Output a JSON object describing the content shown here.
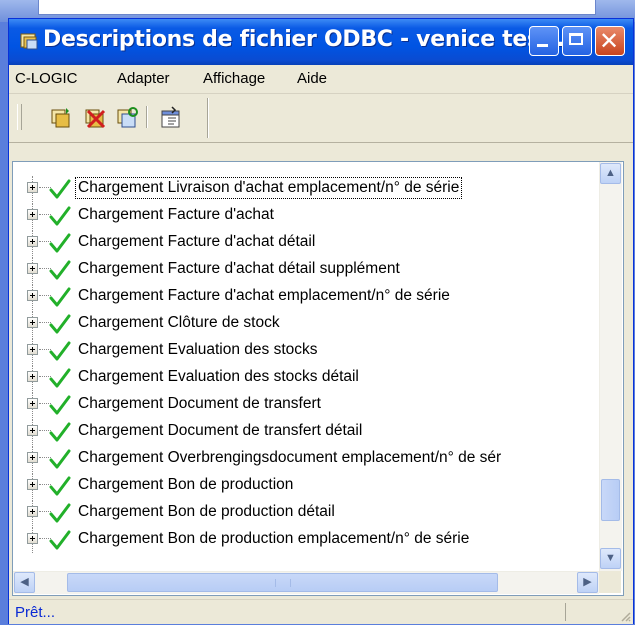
{
  "window": {
    "title": "Descriptions de fichier ODBC - venice tes..."
  },
  "menubar": {
    "items": [
      "C-LOGIC",
      "Adapter",
      "Affichage",
      "Aide"
    ]
  },
  "toolbar": {
    "buttons": [
      "load-icon",
      "delete-icon",
      "refresh-icon",
      "properties-icon"
    ]
  },
  "tree": {
    "items": [
      "Chargement Livraison d'achat emplacement/n° de série",
      "Chargement Facture d'achat",
      "Chargement Facture d'achat détail",
      "Chargement Facture d'achat détail supplément",
      "Chargement Facture d'achat emplacement/n° de série",
      "Chargement Clôture de stock",
      "Chargement Evaluation des stocks",
      "Chargement Evaluation des stocks détail",
      "Chargement Document de transfert",
      "Chargement Document de transfert détail",
      "Chargement Overbrengingsdocument emplacement/n° de sér",
      "Chargement Bon de production",
      "Chargement Bon de production détail",
      "Chargement Bon de production emplacement/n° de série"
    ],
    "selected_index": 0
  },
  "status": {
    "text": "Prêt..."
  },
  "colors": {
    "title_bar": "#0054e3",
    "check": "#22b02a",
    "status_text": "#0a2ad4"
  }
}
